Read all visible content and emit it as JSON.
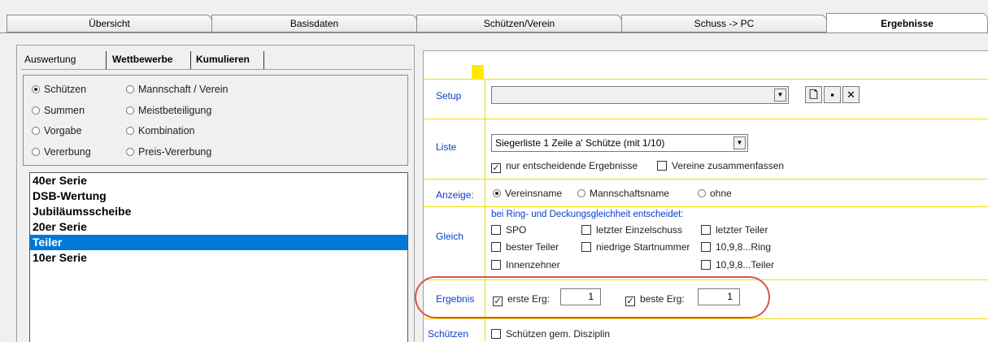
{
  "tabs": [
    "Übersicht",
    "Basisdaten",
    "Schützen/Verein",
    "Schuss -> PC",
    "Ergebnisse"
  ],
  "sub_tabs": [
    "Auswertung",
    "Wettbewerbe",
    "Kumulieren"
  ],
  "radio": {
    "schuetzen": "Schützen",
    "mannschaft": "Mannschaft / Verein",
    "summen": "Summen",
    "meist": "Meistbeteiligung",
    "vorgabe": "Vorgabe",
    "kombination": "Kombination",
    "vererbung": "Vererbung",
    "preis": "Preis-Vererbung"
  },
  "list": [
    "40er Serie",
    "DSB-Wertung",
    "Jubiläumsscheibe",
    "20er Serie",
    "Teiler",
    "10er Serie"
  ],
  "labels": {
    "setup": "Setup",
    "liste": "Liste",
    "anzeige": "Anzeige:",
    "gleich": "Gleich",
    "ergebnis": "Ergebnis",
    "schuetzen": "Schützen"
  },
  "setup": {
    "value": ""
  },
  "liste": {
    "value": "Siegerliste 1 Zeile a' Schütze (mit 1/10)"
  },
  "checks": {
    "nur_entscheidend": "nur entscheidende Ergebnisse",
    "vereine": "Vereine zusammenfassen"
  },
  "anzeige": {
    "vereinsname": "Vereinsname",
    "mannschaftsname": "Mannschaftsname",
    "ohne": "ohne"
  },
  "gleich": {
    "header": "bei Ring- und Deckungsgleichheit entscheidet:",
    "spo": "SPO",
    "letzter_einzelschuss": "letzter Einzelschuss",
    "letzter_teiler": "letzter Teiler",
    "bester_teiler": "bester Teiler",
    "niedrige_startnummer": "niedrige Startnummer",
    "ring": "10,9,8...Ring",
    "innenzehner": "Innenzehner",
    "teiler": "10,9,8...Teiler"
  },
  "ergebnis": {
    "erste": "erste Erg:",
    "erste_value": "1",
    "beste": "beste Erg:",
    "beste_value": "1"
  },
  "schuetzen_gem": "Schützen gem. Disziplin",
  "colors": {
    "accent": "#0078d7",
    "label": "#0a40c8",
    "guide": "#f0e000",
    "highlight": "#d9534f"
  }
}
